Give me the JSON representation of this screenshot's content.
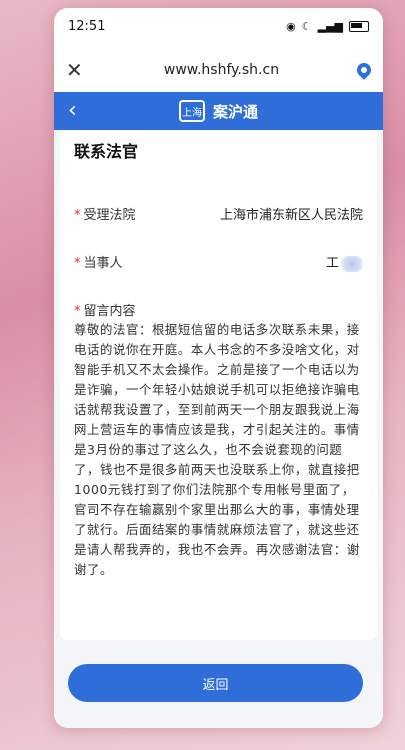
{
  "status": {
    "time": "12:51"
  },
  "browser": {
    "close_icon": "close-icon",
    "url": "www.hshfy.sh.cn",
    "location_icon": "location-pin-icon"
  },
  "appbar": {
    "back_icon": "chevron-left-icon",
    "logo_text": "上海",
    "title": "案沪通"
  },
  "page": {
    "title": "联系法官"
  },
  "form": {
    "court_label": "受理法院",
    "court_value": "上海市浦东新区人民法院",
    "party_label": "当事人",
    "party_value": "工",
    "message_label": "留言内容",
    "message_text": "尊敬的法官：根据短信留的电话多次联系未果，接电话的说你在开庭。本人书念的不多没啥文化，对智能手机又不太会操作。之前是接了一个电话以为是诈骗，一个年轻小姑娘说手机可以拒绝接诈骗电话就帮我设置了，至到前两天一个朋友跟我说上海网上营运车的事情应该是我，才引起关注的。事情是3月份的事过了这么久，也不会说套现的问题了，钱也不是很多前两天也没联系上你，就直接把1000元钱打到了你们法院那个专用帐号里面了，官司不存在输赢别个家里出那么大的事，事情处理了就行。后面结案的事情就麻烦法官了，就这些还是请人帮我弄的，我也不会弄。再次感谢法官：谢谢了。"
  },
  "actions": {
    "return_label": "返回"
  },
  "colors": {
    "accent": "#2f6ed8",
    "required": "#e0302f"
  }
}
